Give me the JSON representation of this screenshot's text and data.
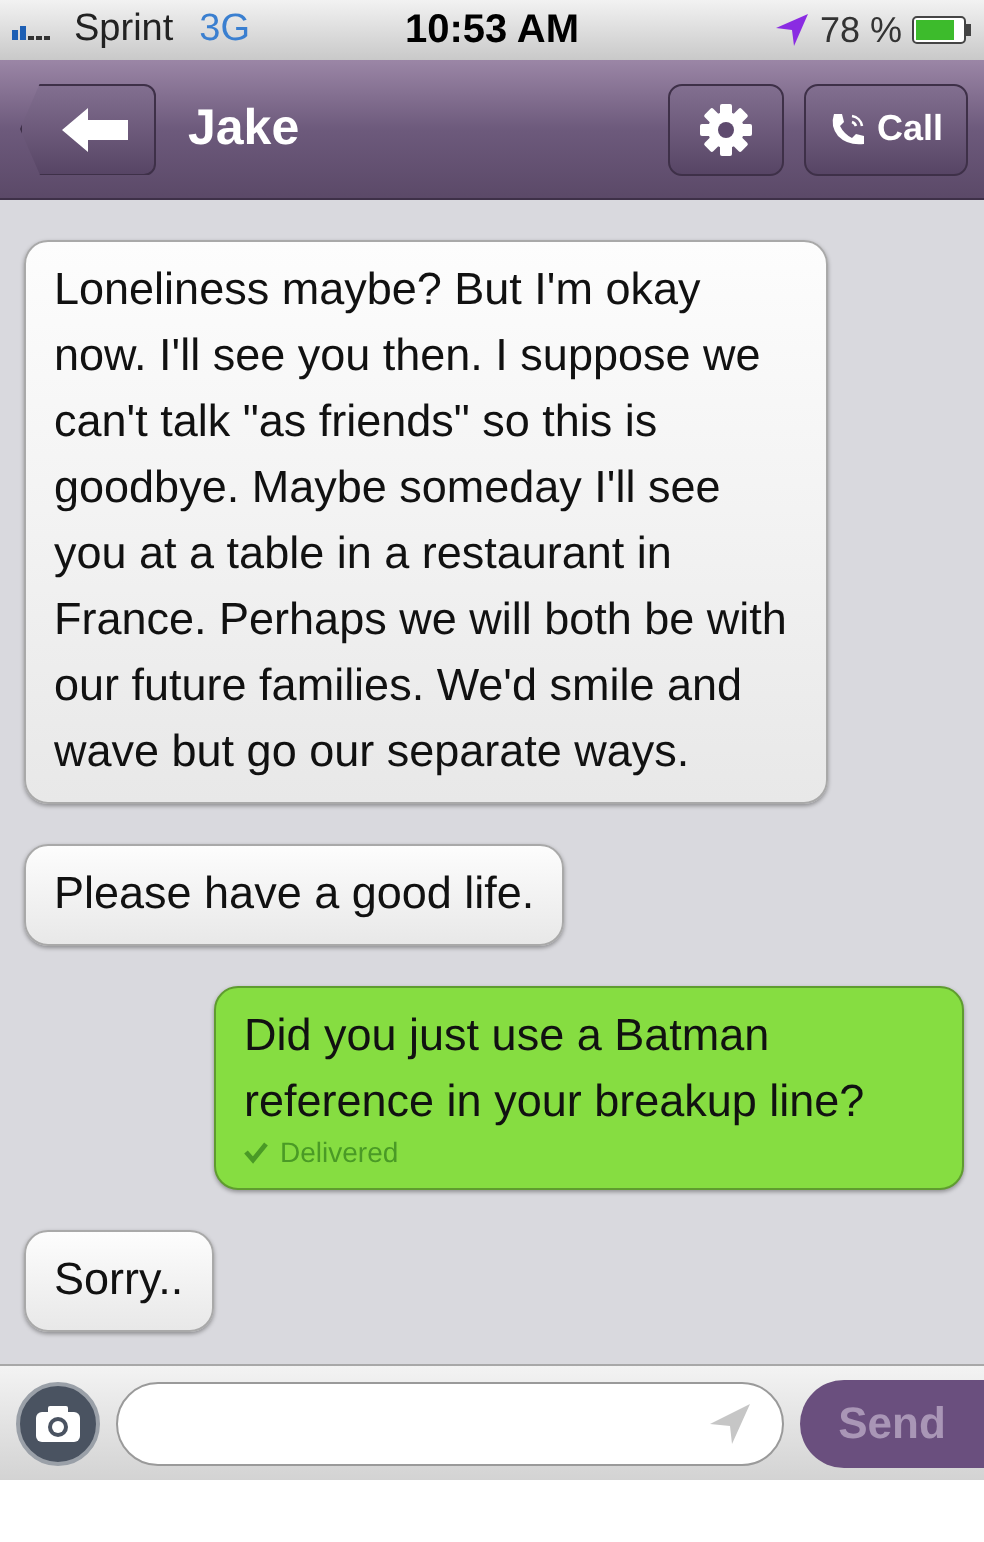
{
  "status_bar": {
    "carrier": "Sprint",
    "network": "3G",
    "time": "10:53 AM",
    "battery": "78 %"
  },
  "header": {
    "title": "Jake",
    "call_label": "Call"
  },
  "messages": [
    {
      "kind": "received",
      "text": "Loneliness maybe? But I'm okay now. I'll see you then. I suppose we can't talk \"as friends\" so this is goodbye. Maybe someday I'll see you at a table in a restaurant in France. Perhaps we will both be with our future families. We'd smile and wave but go our separate ways."
    },
    {
      "kind": "received",
      "text": "Please have a good life."
    },
    {
      "kind": "sent",
      "text": "Did you just use a Batman reference in your breakup line?",
      "status": "Delivered"
    },
    {
      "kind": "received",
      "text": "Sorry.."
    }
  ],
  "composer": {
    "send_label": "Send",
    "send_disabled": true
  }
}
